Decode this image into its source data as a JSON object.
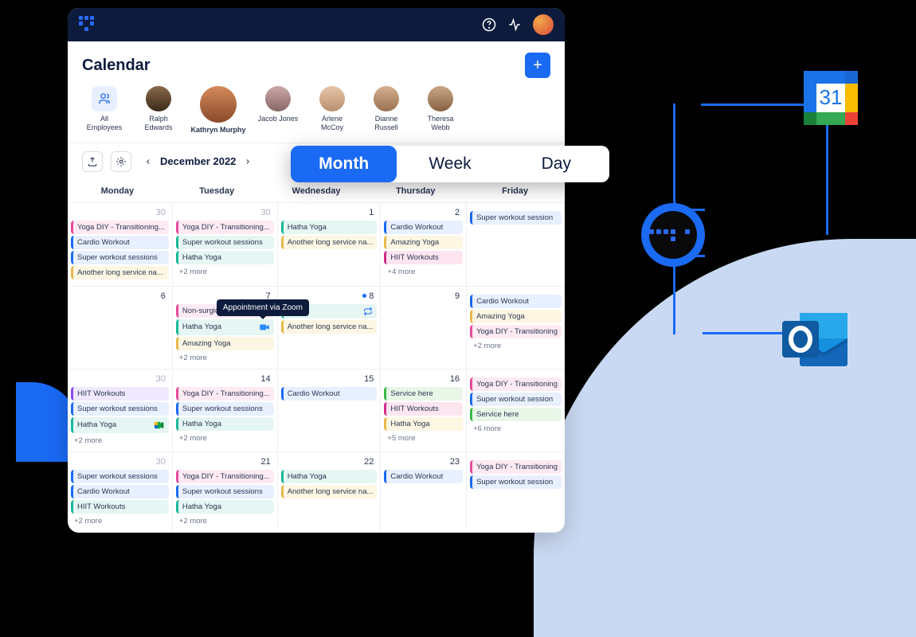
{
  "header": {
    "title": "Calendar"
  },
  "people": [
    {
      "name": "All Employees",
      "all": true
    },
    {
      "name": "Ralph Edwards",
      "av": "av0"
    },
    {
      "name": "Kathryn Murphy",
      "av": "av1",
      "selected": true
    },
    {
      "name": "Jacob Jones",
      "av": "av2"
    },
    {
      "name": "Arlene McCoy",
      "av": "av3"
    },
    {
      "name": "Dianne Russell",
      "av": "av4"
    },
    {
      "name": "Theresa Webb",
      "av": "av5"
    }
  ],
  "toolbar": {
    "month_label": "December 2022"
  },
  "views": {
    "month": "Month",
    "week": "Week",
    "day": "Day",
    "active": "month"
  },
  "weekdays": [
    "Monday",
    "Tuesday",
    "Wednesday",
    "Thursday",
    "Friday"
  ],
  "tooltip": "Appointment via Zoom",
  "grid": [
    [
      {
        "day": "30",
        "muted": true,
        "events": [
          {
            "t": "Yoga DIY - Transitioning...",
            "c": "c-pink"
          },
          {
            "t": "Cardio Workout",
            "c": "c-blue"
          },
          {
            "t": "Super workout sessions",
            "c": "c-blue"
          },
          {
            "t": "Another long service na...",
            "c": "c-yellow"
          }
        ]
      },
      {
        "day": "30",
        "muted": true,
        "events": [
          {
            "t": "Yoga DIY - Transitioning...",
            "c": "c-pink"
          },
          {
            "t": "Super workout sessions",
            "c": "c-teal"
          },
          {
            "t": "Hatha Yoga",
            "c": "c-teal"
          }
        ],
        "more": "+2 more"
      },
      {
        "day": "1",
        "events": [
          {
            "t": "Hatha Yoga",
            "c": "c-teal"
          },
          {
            "t": "Another long service na...",
            "c": "c-yellow"
          }
        ]
      },
      {
        "day": "2",
        "events": [
          {
            "t": "Cardio Workout",
            "c": "c-blue"
          },
          {
            "t": "Amazing Yoga",
            "c": "c-yellow"
          },
          {
            "t": "HIIT Workouts",
            "c": "c-magenta"
          }
        ],
        "more": "+4 more"
      },
      {
        "day": "",
        "events": [
          {
            "t": "Super workout session",
            "c": "c-blue"
          }
        ]
      }
    ],
    [
      {
        "day": "6",
        "events": []
      },
      {
        "day": "7",
        "events": [
          {
            "t": "Non-surgic",
            "c": "c-pink",
            "tooltip": true
          },
          {
            "t": "Hatha Yoga",
            "c": "c-teal",
            "zoom": true
          },
          {
            "t": "Amazing Yoga",
            "c": "c-yellow"
          }
        ],
        "more": "+2 more"
      },
      {
        "day": "8",
        "dot": true,
        "events": [
          {
            "t": "oga",
            "c": "c-teal",
            "recur": true
          },
          {
            "t": "Another long service na...",
            "c": "c-yellow"
          }
        ]
      },
      {
        "day": "9",
        "events": []
      },
      {
        "day": "",
        "events": [
          {
            "t": "Cardio Workout",
            "c": "c-blue"
          },
          {
            "t": "Amazing Yoga",
            "c": "c-yellow"
          },
          {
            "t": "Yoga DIY - Transitioning",
            "c": "c-pink"
          }
        ],
        "more": "+2 more"
      }
    ],
    [
      {
        "day": "30",
        "muted": true,
        "events": [
          {
            "t": "HIIT Workouts",
            "c": "c-purple"
          },
          {
            "t": "Super workout sessions",
            "c": "c-blue"
          },
          {
            "t": "Hatha Yoga",
            "c": "c-teal",
            "gmeet": true
          }
        ],
        "more": "+2 more"
      },
      {
        "day": "14",
        "events": [
          {
            "t": "Yoga DIY - Transitioning...",
            "c": "c-pink"
          },
          {
            "t": "Super workout sessions",
            "c": "c-blue"
          },
          {
            "t": "Hatha Yoga",
            "c": "c-teal"
          }
        ],
        "more": "+2 more"
      },
      {
        "day": "15",
        "events": [
          {
            "t": "Cardio Workout",
            "c": "c-blue"
          }
        ]
      },
      {
        "day": "16",
        "events": [
          {
            "t": "Service here",
            "c": "c-green"
          },
          {
            "t": "HIIT Workouts",
            "c": "c-magenta"
          },
          {
            "t": "Hatha Yoga",
            "c": "c-yellow"
          }
        ],
        "more": "+5 more"
      },
      {
        "day": "",
        "events": [
          {
            "t": "Yoga DIY - Transitioning",
            "c": "c-pink"
          },
          {
            "t": "Super workout session",
            "c": "c-blue"
          },
          {
            "t": "Service here",
            "c": "c-green"
          }
        ],
        "more": "+6 more"
      }
    ],
    [
      {
        "day": "30",
        "muted": true,
        "events": [
          {
            "t": "Super workout sessions",
            "c": "c-blue"
          },
          {
            "t": "Cardio Workout",
            "c": "c-blue"
          },
          {
            "t": "HIIT Workouts",
            "c": "c-teal"
          }
        ],
        "more": "+2 more"
      },
      {
        "day": "21",
        "events": [
          {
            "t": "Yoga DIY - Transitioning...",
            "c": "c-pink"
          },
          {
            "t": "Super workout sessions",
            "c": "c-blue"
          },
          {
            "t": "Hatha Yoga",
            "c": "c-teal"
          }
        ],
        "more": "+2 more"
      },
      {
        "day": "22",
        "events": [
          {
            "t": "Hatha Yoga",
            "c": "c-teal"
          },
          {
            "t": "Another long service na...",
            "c": "c-yellow"
          }
        ]
      },
      {
        "day": "23",
        "events": [
          {
            "t": "Cardio Workout",
            "c": "c-blue"
          }
        ]
      },
      {
        "day": "",
        "events": [
          {
            "t": "Yoga DIY - Transitioning",
            "c": "c-pink"
          },
          {
            "t": "Super workout session",
            "c": "c-blue"
          }
        ]
      }
    ]
  ],
  "integrations": {
    "gcal_day": "31"
  }
}
